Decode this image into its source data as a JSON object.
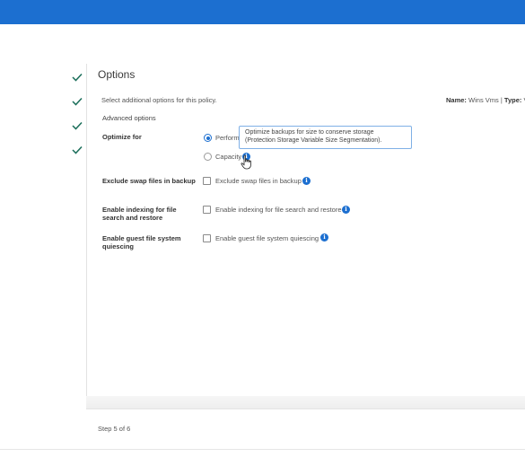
{
  "page": {
    "title": "Options",
    "subtitle": "Select additional options for this policy.",
    "meta_name_label": "Name:",
    "meta_name_value": "Wins Vms",
    "meta_separator": "|",
    "meta_type_label": "Type:",
    "meta_type_value": "V",
    "section_title": "Advanced options"
  },
  "wizard": {
    "completed_steps": 4,
    "step_indicator": "Step 5 of 6"
  },
  "optimize": {
    "label": "Optimize for",
    "options": [
      {
        "label": "Perform",
        "selected": true
      },
      {
        "label": "Capacity",
        "selected": false
      }
    ],
    "tooltip": "Optimize backups for size to conserve storage (Protection Storage Variable Size Segmentation)."
  },
  "settings": [
    {
      "label": "Exclude swap files in backup",
      "checkbox_label": "Exclude swap files in backup",
      "checked": false
    },
    {
      "label": "Enable indexing for file search and restore",
      "checkbox_label": "Enable indexing for file search and restore",
      "checked": false
    },
    {
      "label": "Enable guest file system quiescing",
      "checkbox_label": "Enable guest file system quiescing",
      "checked": false
    }
  ],
  "icons": {
    "check": "checkmark-icon",
    "info": "info-icon",
    "cursor": "hand-pointer-icon"
  },
  "colors": {
    "brand": "#1c6fd0",
    "check": "#1a6e5a"
  }
}
